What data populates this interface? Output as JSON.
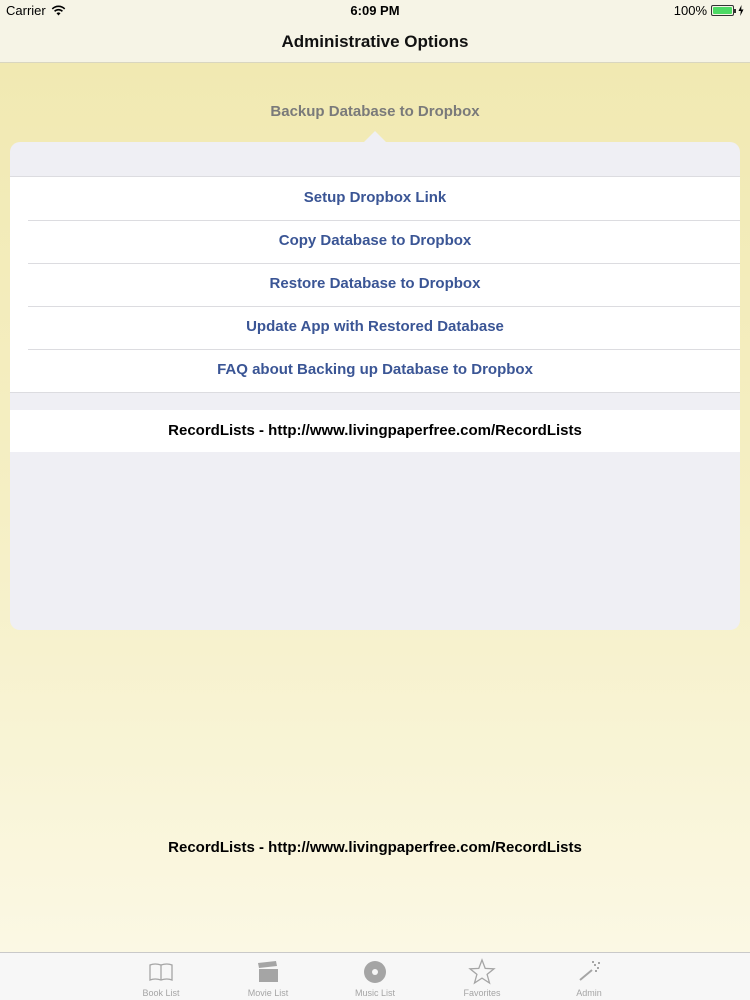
{
  "status_bar": {
    "carrier": "Carrier",
    "time": "6:09 PM",
    "battery": "100%",
    "battery_level": 1.0
  },
  "nav": {
    "title": "Administrative Options"
  },
  "popover": {
    "title": "Backup Database to Dropbox",
    "items": [
      {
        "label": "Setup Dropbox Link"
      },
      {
        "label": "Copy Database to Dropbox"
      },
      {
        "label": "Restore Database to Dropbox"
      },
      {
        "label": "Update App with Restored Database"
      },
      {
        "label": "FAQ about Backing up Database to Dropbox"
      }
    ],
    "link_text": "RecordLists - http://www.livingpaperfree.com/RecordLists"
  },
  "footer": {
    "link_text": "RecordLists - http://www.livingpaperfree.com/RecordLists"
  },
  "tabs": [
    {
      "label": "Book List",
      "icon": "book-icon"
    },
    {
      "label": "Movie List",
      "icon": "clapperboard-icon"
    },
    {
      "label": "Music List",
      "icon": "disc-icon"
    },
    {
      "label": "Favorites",
      "icon": "star-icon"
    },
    {
      "label": "Admin",
      "icon": "wand-icon"
    }
  ],
  "colors": {
    "menu_text": "#3a5595",
    "background_gradient_top": "#f1e9b2",
    "battery_green": "#4cd964",
    "tab_inactive": "#a5a5a5"
  }
}
